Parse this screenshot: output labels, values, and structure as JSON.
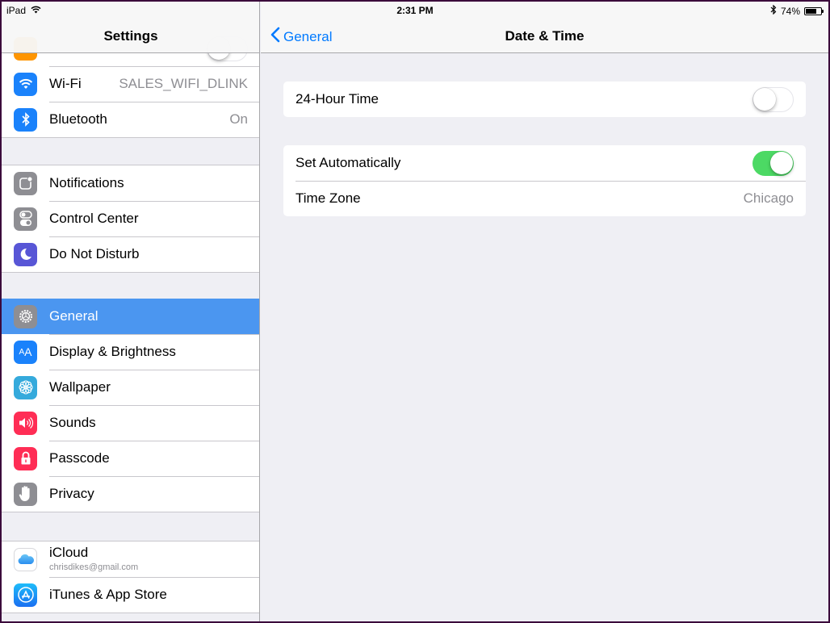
{
  "status_bar": {
    "device": "iPad",
    "time": "2:31 PM",
    "battery_percent": "74%",
    "battery_level": 0.74
  },
  "master": {
    "title": "Settings",
    "partial_row": {
      "icon": "airplane-icon",
      "toggle_on": false
    },
    "groups": [
      {
        "items": [
          {
            "label": "Wi-Fi",
            "value": "SALES_WIFI_DLINK",
            "icon": "wifi-icon",
            "color": "#1a82fb"
          },
          {
            "label": "Bluetooth",
            "value": "On",
            "icon": "bluetooth-icon",
            "color": "#1a82fb"
          }
        ]
      },
      {
        "items": [
          {
            "label": "Notifications",
            "icon": "notifications-icon",
            "color": "#8e8e93"
          },
          {
            "label": "Control Center",
            "icon": "control-center-icon",
            "color": "#8e8e93"
          },
          {
            "label": "Do Not Disturb",
            "icon": "moon-icon",
            "color": "#5856d6"
          }
        ]
      },
      {
        "items": [
          {
            "label": "General",
            "icon": "gear-icon",
            "color": "#8e8e93",
            "selected": true
          },
          {
            "label": "Display & Brightness",
            "icon": "display-brightness-icon",
            "color": "#1a82fb"
          },
          {
            "label": "Wallpaper",
            "icon": "wallpaper-icon",
            "color": "#35aadc"
          },
          {
            "label": "Sounds",
            "icon": "speaker-icon",
            "color": "#ff2d55"
          },
          {
            "label": "Passcode",
            "icon": "lock-icon",
            "color": "#ff2d55"
          },
          {
            "label": "Privacy",
            "icon": "hand-icon",
            "color": "#8e8e93"
          }
        ]
      },
      {
        "items": [
          {
            "label": "iCloud",
            "sublabel": "chrisdikes@gmail.com",
            "icon": "icloud-icon",
            "color": "#ffffff"
          },
          {
            "label": "iTunes & App Store",
            "icon": "app-store-icon",
            "color": "#1a82fb"
          }
        ]
      }
    ]
  },
  "detail": {
    "back_label": "General",
    "title": "Date & Time",
    "sections": [
      {
        "rows": [
          {
            "label": "24-Hour Time",
            "toggle_on": false
          }
        ]
      },
      {
        "rows": [
          {
            "label": "Set Automatically",
            "toggle_on": true
          },
          {
            "label": "Time Zone",
            "value": "Chicago"
          }
        ]
      }
    ]
  },
  "colors": {
    "accent": "#007aff",
    "selected_row": "#4b96f0",
    "toggle_on": "#4cd964",
    "background": "#efeff4",
    "frame": "#3b0a3b"
  }
}
